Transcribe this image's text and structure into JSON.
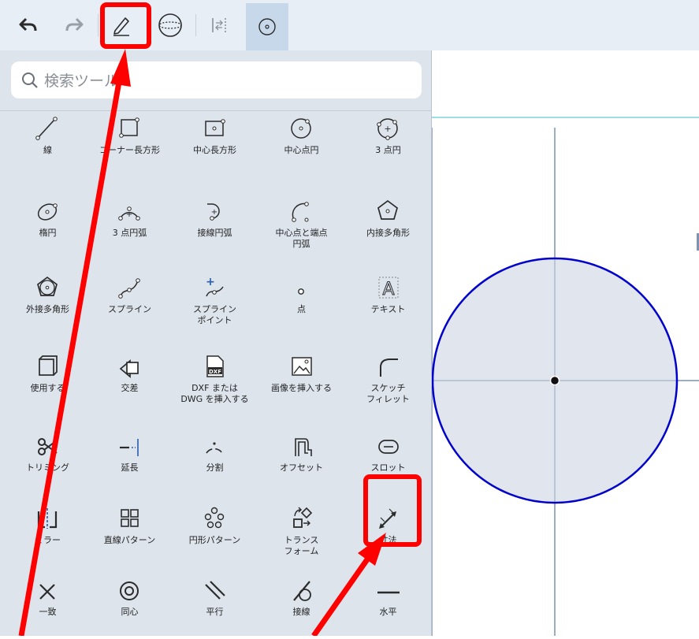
{
  "toolbar": {
    "items": [
      "undo-icon",
      "redo-icon",
      "sketch-pencil-icon",
      "view-sphere-icon",
      "align-icon",
      "circle-tool-icon"
    ]
  },
  "search": {
    "placeholder": "検索ツール"
  },
  "tools": [
    {
      "label": "線",
      "icon": "line-icon"
    },
    {
      "label": "コーナー長方形",
      "icon": "corner-rectangle-icon"
    },
    {
      "label": "中心長方形",
      "icon": "center-rectangle-icon"
    },
    {
      "label": "中心点円",
      "icon": "center-circle-icon"
    },
    {
      "label": "3 点円",
      "icon": "three-point-circle-icon"
    },
    {
      "label": "楕円",
      "icon": "ellipse-icon"
    },
    {
      "label": "3 点円弧",
      "icon": "three-point-arc-icon"
    },
    {
      "label": "接線円弧",
      "icon": "tangent-arc-icon"
    },
    {
      "label": "中心点と端点\n円弧",
      "icon": "center-point-arc-icon"
    },
    {
      "label": "内接多角形",
      "icon": "inscribed-polygon-icon"
    },
    {
      "label": "外接多角形",
      "icon": "circumscribed-polygon-icon"
    },
    {
      "label": "スプライン",
      "icon": "spline-icon"
    },
    {
      "label": "スプライン\nポイント",
      "icon": "spline-point-icon"
    },
    {
      "label": "点",
      "icon": "point-icon"
    },
    {
      "label": "テキスト",
      "icon": "text-icon"
    },
    {
      "label": "使用する",
      "icon": "use-icon"
    },
    {
      "label": "交差",
      "icon": "intersect-icon"
    },
    {
      "label": "DXF または\nDWG を挿入する",
      "icon": "insert-dxf-icon"
    },
    {
      "label": "画像を挿入する",
      "icon": "insert-image-icon"
    },
    {
      "label": "スケッチ\nフィレット",
      "icon": "sketch-fillet-icon"
    },
    {
      "label": "トリミング",
      "icon": "trim-icon"
    },
    {
      "label": "延長",
      "icon": "extend-icon"
    },
    {
      "label": "分割",
      "icon": "split-icon"
    },
    {
      "label": "オフセット",
      "icon": "offset-icon"
    },
    {
      "label": "スロット",
      "icon": "slot-icon"
    },
    {
      "label": "ミラー",
      "icon": "mirror-icon"
    },
    {
      "label": "直線パターン",
      "icon": "linear-pattern-icon"
    },
    {
      "label": "円形パターン",
      "icon": "circular-pattern-icon"
    },
    {
      "label": "トランス\nフォーム",
      "icon": "transform-icon"
    },
    {
      "label": "寸法",
      "icon": "dimension-icon"
    },
    {
      "label": "一致",
      "icon": "coincident-icon"
    },
    {
      "label": "同心",
      "icon": "concentric-icon"
    },
    {
      "label": "平行",
      "icon": "parallel-icon"
    },
    {
      "label": "接線",
      "icon": "tangent-icon"
    },
    {
      "label": "水平",
      "icon": "horizontal-icon"
    }
  ],
  "colors": {
    "panel_bg": "#dde4ec",
    "toolbar_bg": "#e8eef6",
    "circle_stroke": "#0000cc",
    "annotation": "#ff0000"
  }
}
